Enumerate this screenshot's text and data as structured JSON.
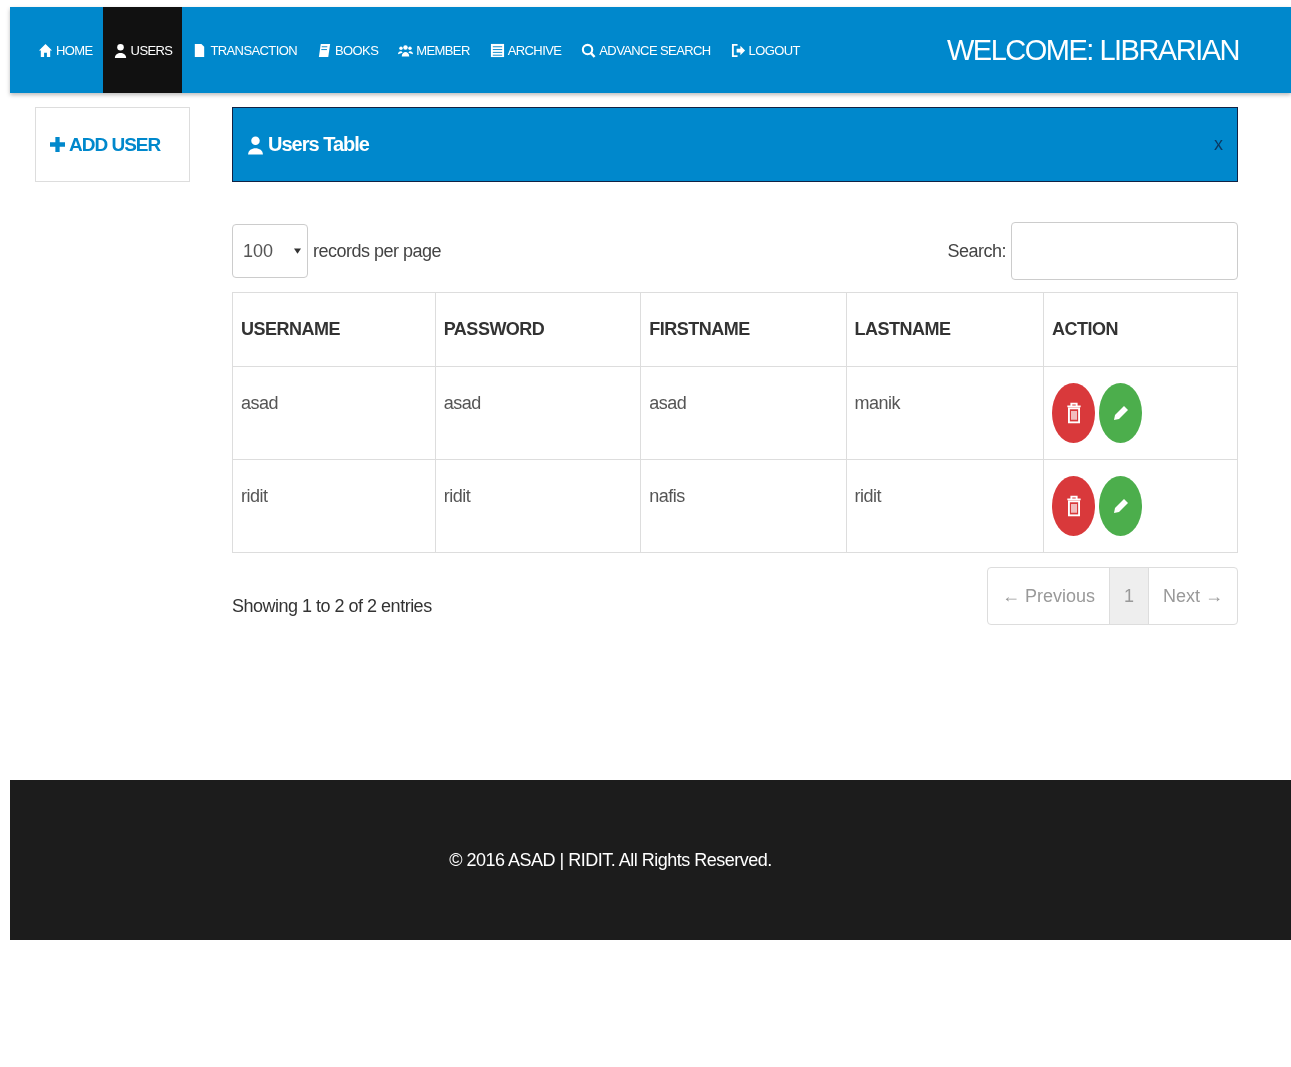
{
  "nav": {
    "items": [
      {
        "label": "HOME",
        "selected": false
      },
      {
        "label": "USERS",
        "selected": true
      },
      {
        "label": "TRANSACTION",
        "selected": false
      },
      {
        "label": "BOOKS",
        "selected": false
      },
      {
        "label": "MEMBER",
        "selected": false
      },
      {
        "label": "ARCHIVE",
        "selected": false
      },
      {
        "label": "ADVANCE SEARCH",
        "selected": false
      },
      {
        "label": "LOGOUT",
        "selected": false
      }
    ],
    "welcome": "WELCOME: LIBRARIAN"
  },
  "sidebar": {
    "button": "ADD USER"
  },
  "panel": {
    "title": "Users Table",
    "close": "x"
  },
  "controls": {
    "per_page": "100",
    "per_page_label": "records per page",
    "search_label": "Search:"
  },
  "table": {
    "columns": [
      "USERNAME",
      "PASSWORD",
      "FIRSTNAME",
      "LASTNAME",
      "ACTION"
    ],
    "rows": [
      [
        "asad",
        "asad",
        "asad",
        "manik"
      ],
      [
        "ridit",
        "ridit",
        "nafis",
        "ridit"
      ]
    ]
  },
  "info": "Showing 1 to 2 of 2 entries",
  "pagination": [
    {
      "label": "← Previous",
      "disabled": true,
      "selected": false
    },
    {
      "label": "1",
      "disabled": false,
      "selected": true
    },
    {
      "label": "Next →",
      "disabled": true,
      "selected": false
    }
  ],
  "footer": "© 2016 ASAD | RIDIT. All Rights Reserved."
}
